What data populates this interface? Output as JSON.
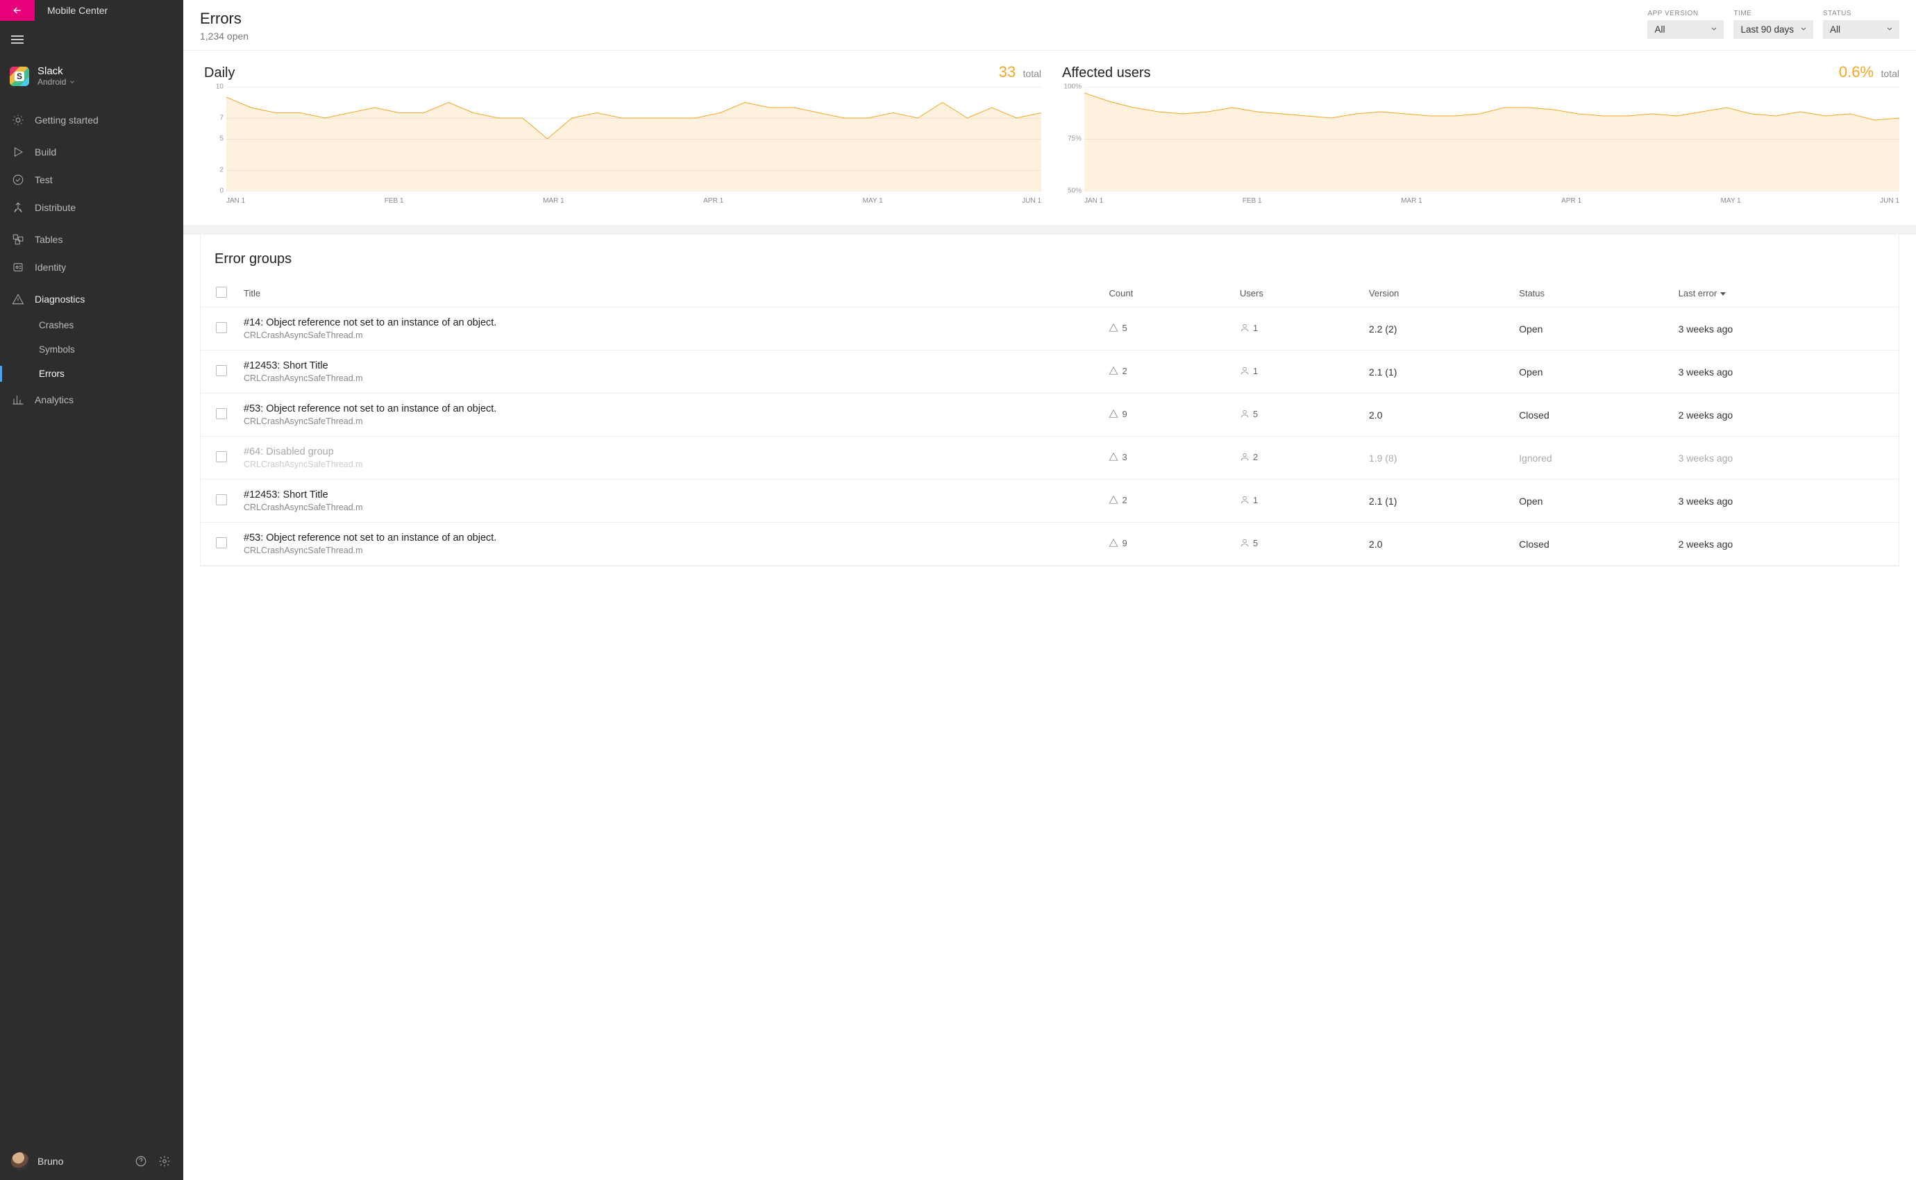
{
  "brand": "Mobile Center",
  "app": {
    "name": "Slack",
    "platform": "Android"
  },
  "nav": {
    "getting_started": "Getting started",
    "build": "Build",
    "test": "Test",
    "distribute": "Distribute",
    "tables": "Tables",
    "identity": "Identity",
    "diagnostics": "Diagnostics",
    "crashes": "Crashes",
    "symbols": "Symbols",
    "errors": "Errors",
    "analytics": "Analytics"
  },
  "user": {
    "name": "Bruno"
  },
  "page": {
    "title": "Errors",
    "sub": "1,234 open"
  },
  "filters": {
    "app_version": {
      "label": "APP VERSION",
      "value": "All"
    },
    "time": {
      "label": "TIME",
      "value": "Last 90 days"
    },
    "status": {
      "label": "STATUS",
      "value": "All"
    }
  },
  "chart_data": [
    {
      "type": "area",
      "title": "Daily",
      "summary_value": "33",
      "summary_suffix": "total",
      "ylabel": "",
      "xlabel": "",
      "y_ticks": [
        "10",
        "7",
        "5",
        "2",
        "0"
      ],
      "ylim": [
        0,
        10
      ],
      "categories": [
        "JAN 1",
        "FEB 1",
        "MAR 1",
        "APR 1",
        "MAY 1",
        "JUN 1"
      ],
      "values": [
        9,
        8,
        7.5,
        7.5,
        7,
        7.5,
        8,
        7.5,
        7.5,
        8.5,
        7.5,
        7,
        7,
        5,
        7,
        7.5,
        7,
        7,
        7,
        7,
        7.5,
        8.5,
        8,
        8,
        7.5,
        7,
        7,
        7.5,
        7,
        8.5,
        7,
        8,
        7,
        7.5
      ],
      "color": "#f5a623"
    },
    {
      "type": "area",
      "title": "Affected users",
      "summary_value": "0.6%",
      "summary_suffix": "total",
      "ylabel": "",
      "xlabel": "",
      "y_ticks": [
        "100%",
        "75%",
        "50%"
      ],
      "ylim": [
        50,
        100
      ],
      "categories": [
        "JAN 1",
        "FEB 1",
        "MAR 1",
        "APR 1",
        "MAY 1",
        "JUN 1"
      ],
      "values": [
        97,
        93,
        90,
        88,
        87,
        88,
        90,
        88,
        87,
        86,
        85,
        87,
        88,
        87,
        86,
        86,
        87,
        90,
        90,
        89,
        87,
        86,
        86,
        87,
        86,
        88,
        90,
        87,
        86,
        88,
        86,
        87,
        84,
        85
      ],
      "color": "#f5a623"
    }
  ],
  "groups": {
    "title": "Error groups",
    "headers": {
      "title": "Title",
      "count": "Count",
      "users": "Users",
      "version": "Version",
      "status": "Status",
      "last": "Last error"
    },
    "rows": [
      {
        "title": "#14: Object reference not set to an instance of an object.",
        "sub": "CRLCrashAsyncSafeThread.m",
        "count": "5",
        "users": "1",
        "version": "2.2 (2)",
        "status": "Open",
        "status_class": "open",
        "last": "3 weeks ago",
        "muted": false
      },
      {
        "title": "#12453: Short Title",
        "sub": "CRLCrashAsyncSafeThread.m",
        "count": "2",
        "users": "1",
        "version": "2.1 (1)",
        "status": "Open",
        "status_class": "open",
        "last": "3 weeks ago",
        "muted": false
      },
      {
        "title": "#53: Object reference not set to an instance of an object.",
        "sub": "CRLCrashAsyncSafeThread.m",
        "count": "9",
        "users": "5",
        "version": "2.0",
        "status": "Closed",
        "status_class": "",
        "last": "2 weeks ago",
        "muted": false
      },
      {
        "title": "#64: Disabled group",
        "sub": "CRLCrashAsyncSafeThread.m",
        "count": "3",
        "users": "2",
        "version": "1.9 (8)",
        "status": "Ignored",
        "status_class": "",
        "last": "3 weeks ago",
        "muted": true
      },
      {
        "title": "#12453: Short Title",
        "sub": "CRLCrashAsyncSafeThread.m",
        "count": "2",
        "users": "1",
        "version": "2.1 (1)",
        "status": "Open",
        "status_class": "open",
        "last": "3 weeks ago",
        "muted": false
      },
      {
        "title": "#53: Object reference not set to an instance of an object.",
        "sub": "CRLCrashAsyncSafeThread.m",
        "count": "9",
        "users": "5",
        "version": "2.0",
        "status": "Closed",
        "status_class": "",
        "last": "2 weeks ago",
        "muted": false
      }
    ]
  }
}
